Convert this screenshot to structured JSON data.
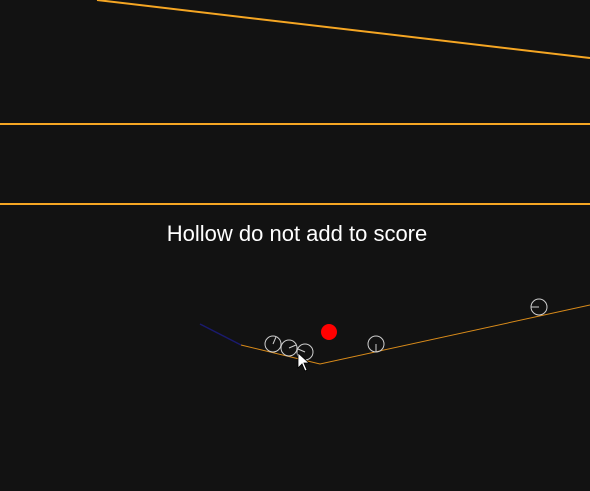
{
  "game": {
    "hint": "Hollow do not add to score",
    "colors": {
      "background": "#121212",
      "wall": "#f5a623",
      "ramp": "#d98b1a",
      "flipper": "#1a1a6e",
      "hollow_ball": "#cfcfcf",
      "solid_ball": "#ff0000",
      "cursor": "#ffffff"
    },
    "icons": {
      "cursor": "mouse-pointer-icon"
    }
  }
}
